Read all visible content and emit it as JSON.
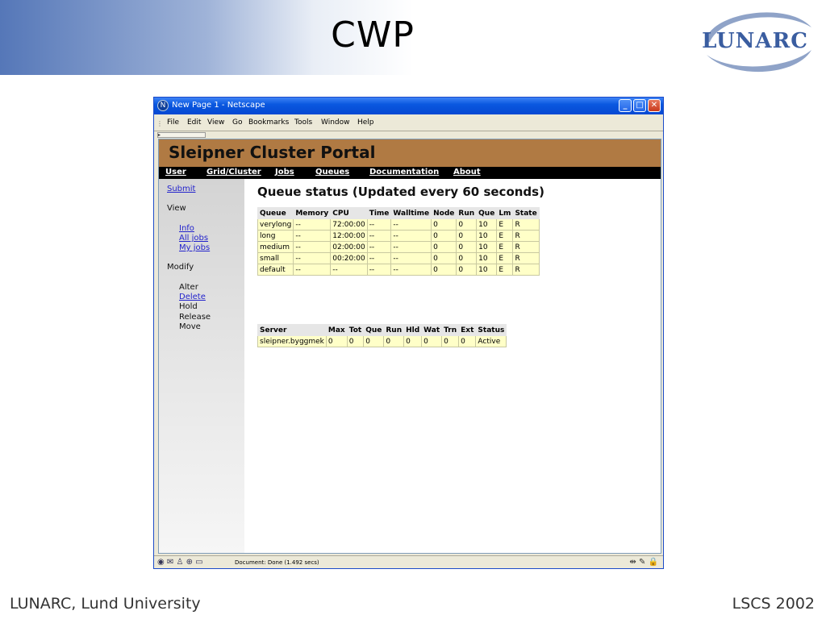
{
  "slide": {
    "title": "CWP",
    "logo_text": "LUNARC",
    "footer_left": "LUNARC, Lund University",
    "footer_right": "LSCS 2002"
  },
  "window": {
    "title": "New Page 1 - Netscape",
    "menu": [
      "File",
      "Edit",
      "View",
      "Go",
      "Bookmarks",
      "Tools",
      "Window",
      "Help"
    ]
  },
  "portal": {
    "title": "Sleipner Cluster Portal",
    "nav": [
      "User",
      "Grid/Cluster",
      "Jobs",
      "Queues",
      "Documentation",
      "About"
    ]
  },
  "sidebar": {
    "submit": "Submit",
    "view_heading": "View",
    "view_links": [
      "Info",
      "All jobs",
      "My jobs"
    ],
    "modify_heading": "Modify",
    "modify_items": [
      {
        "label": "Alter",
        "link": false
      },
      {
        "label": "Delete",
        "link": true
      },
      {
        "label": "Hold",
        "link": false
      },
      {
        "label": "Release",
        "link": false
      },
      {
        "label": "Move",
        "link": false
      }
    ]
  },
  "main": {
    "heading": "Queue status (Updated every 60 seconds)",
    "queue_table": {
      "headers": [
        "Queue",
        "Memory",
        "CPU",
        "Time",
        "Walltime",
        "Node",
        "Run",
        "Que",
        "Lm",
        "State"
      ],
      "rows": [
        [
          "verylong",
          "--",
          "72:00:00",
          "--",
          "--",
          "0",
          "0",
          "10",
          "E",
          "R"
        ],
        [
          "long",
          "--",
          "12:00:00",
          "--",
          "--",
          "0",
          "0",
          "10",
          "E",
          "R"
        ],
        [
          "medium",
          "--",
          "02:00:00",
          "--",
          "--",
          "0",
          "0",
          "10",
          "E",
          "R"
        ],
        [
          "small",
          "--",
          "00:20:00",
          "--",
          "--",
          "0",
          "0",
          "10",
          "E",
          "R"
        ],
        [
          "default",
          "--",
          "--",
          "--",
          "--",
          "0",
          "0",
          "10",
          "E",
          "R"
        ]
      ]
    },
    "server_table": {
      "headers": [
        "Server",
        "Max",
        "Tot",
        "Que",
        "Run",
        "Hld",
        "Wat",
        "Trn",
        "Ext",
        "Status"
      ],
      "rows": [
        [
          "sleipner.byggmek",
          "0",
          "0",
          "0",
          "0",
          "0",
          "0",
          "0",
          "0",
          "Active"
        ]
      ]
    }
  },
  "statusbar": {
    "text": "Document: Done (1.492 secs)"
  },
  "colors": {
    "banner": "#b07a43",
    "titlebar": "#0a58e0",
    "cell_bg": "#ffffc8",
    "link": "#2222cc"
  }
}
